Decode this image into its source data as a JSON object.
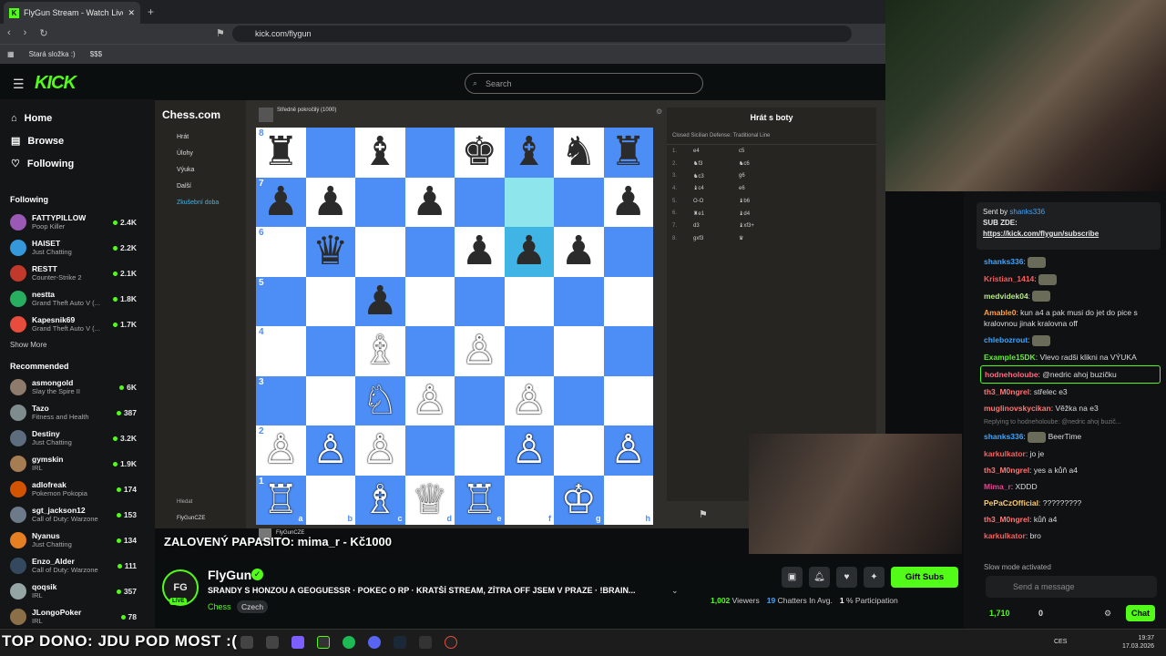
{
  "browser": {
    "tab_title": "FlyGun Stream - Watch Live o",
    "new_tab": "+",
    "url": "kick.com/flygun",
    "bookmarks": [
      "Stará složka :)",
      "$$$"
    ]
  },
  "kick": {
    "logo": "KICK",
    "search_placeholder": "Search",
    "nav": [
      {
        "label": "Home",
        "icon": "home-icon"
      },
      {
        "label": "Browse",
        "icon": "browse-icon"
      },
      {
        "label": "Following",
        "icon": "heart-icon"
      }
    ],
    "following_title": "Following",
    "following": [
      {
        "name": "FATTYPILLOW",
        "game": "Poop Killer",
        "count": "2.4K",
        "color": "#9b59b6"
      },
      {
        "name": "HAISET",
        "game": "Just Chatting",
        "count": "2.2K",
        "color": "#3498db"
      },
      {
        "name": "RESTT",
        "game": "Counter-Strike 2",
        "count": "2.1K",
        "color": "#c0392b"
      },
      {
        "name": "nestta",
        "game": "Grand Theft Auto V (...",
        "count": "1.8K",
        "color": "#27ae60"
      },
      {
        "name": "Kapesnik69",
        "game": "Grand Theft Auto V (...",
        "count": "1.7K",
        "color": "#e74c3c"
      }
    ],
    "show_more": "Show More",
    "recommended_title": "Recommended",
    "recommended": [
      {
        "name": "asmongold",
        "game": "Slay the Spire II",
        "count": "6K",
        "color": "#8e7b6b"
      },
      {
        "name": "Tazo",
        "game": "Fitness and Health",
        "count": "387",
        "color": "#7f8c8d"
      },
      {
        "name": "Destiny",
        "game": "Just Chatting",
        "count": "3.2K",
        "color": "#5d6d7e"
      },
      {
        "name": "gymskin",
        "game": "IRL",
        "count": "1.9K",
        "color": "#a67c52"
      },
      {
        "name": "adlofreak",
        "game": "Pokemon Pokopia",
        "count": "174",
        "color": "#d35400"
      },
      {
        "name": "sgt_jackson12",
        "game": "Call of Duty: Warzone",
        "count": "153",
        "color": "#6c7a89"
      },
      {
        "name": "Nyanus",
        "game": "Just Chatting",
        "count": "134",
        "color": "#e67e22"
      },
      {
        "name": "Enzo_Alder",
        "game": "Call of Duty: Warzone",
        "count": "111",
        "color": "#34495e"
      },
      {
        "name": "qoqsik",
        "game": "IRL",
        "count": "357",
        "color": "#95a5a6"
      },
      {
        "name": "JLongoPoker",
        "game": "IRL",
        "count": "78",
        "color": "#8b6f47"
      }
    ]
  },
  "chesscom": {
    "logo": "Chess.com",
    "menu": [
      "Hrát",
      "Úlohy",
      "Výuka",
      "Další",
      "Zkušební doba"
    ],
    "search": "Hledat",
    "user": "FlyGunCZE",
    "opponent": "Středně pokročilý (1000)",
    "player": "FlyGunCZE",
    "panel_title": "Hrát s boty",
    "opening": "Closed Sicilian Defense: Traditional Line",
    "moves": [
      [
        "1.",
        "e4",
        "c5"
      ],
      [
        "2.",
        "♞f3",
        "♞c6"
      ],
      [
        "3.",
        "♞c3",
        "g6"
      ],
      [
        "4.",
        "♝c4",
        "e6"
      ],
      [
        "5.",
        "O-O",
        "♝b6"
      ],
      [
        "6.",
        "♜e1",
        "♝d4"
      ],
      [
        "7.",
        "d3",
        "♝xf3+"
      ],
      [
        "8.",
        "gxf3",
        "♛"
      ]
    ],
    "board": [
      [
        "♜",
        "",
        "♝",
        "",
        "♚",
        "♝",
        "♞",
        "♜"
      ],
      [
        "♟",
        "♟",
        "",
        "♟",
        "",
        "",
        "",
        "♟"
      ],
      [
        "",
        "♛",
        "",
        "",
        "♟",
        "♟",
        "♟",
        ""
      ],
      [
        "",
        "",
        "♟",
        "",
        "",
        "",
        "",
        ""
      ],
      [
        "",
        "",
        "♗",
        "",
        "♙",
        "",
        "",
        ""
      ],
      [
        "",
        "",
        "♘",
        "♙",
        "",
        "♙",
        "",
        ""
      ],
      [
        "♙",
        "♙",
        "♙",
        "",
        "",
        "♙",
        "",
        "♙"
      ],
      [
        "♖",
        "",
        "♗",
        "♕",
        "♖",
        "",
        "♔",
        ""
      ]
    ],
    "ranks": [
      "8",
      "7",
      "6",
      "5",
      "4",
      "3",
      "2",
      "1"
    ],
    "files": [
      "a",
      "b",
      "c",
      "d",
      "e",
      "f",
      "g",
      "h"
    ]
  },
  "overlay": {
    "subtitle": "ZALOVENÝ PAPASITO: mima_r - Kč1000",
    "top_dono": "TOP DONO: JDU POD MOST :("
  },
  "stream": {
    "channel": "FlyGun",
    "avatar_text": "FG",
    "live": "LIVE",
    "title": "SRANDY S HONZOU A GEOGUESSR · POKEC O RP · KRATŠÍ STREAM, ZÍTRA OFF JSEM V PRAZE · !BRAIN...",
    "category": "Chess",
    "tag": "Czech",
    "gift_label": "Gift Subs",
    "viewers": "1,002",
    "viewers_label": "Viewers",
    "chatters": "19",
    "chatters_label": "Chatters In Avg.",
    "participation": "1",
    "participation_label": "% Participation"
  },
  "chat": {
    "pinned_sent_by": "Sent by",
    "pinned_user": "shanks336",
    "pinned_text": "SUB ZDE:",
    "pinned_link": "https://kick.com/flygun/subscribe",
    "messages": [
      {
        "user": "shanks336",
        "text": "",
        "color": "#3ea6ff",
        "emote": true
      },
      {
        "user": "Kristian_1414",
        "text": "",
        "color": "#ff5c5c",
        "emote": true
      },
      {
        "user": "medvidek04",
        "text": "",
        "color": "#b8e986",
        "emote": true
      },
      {
        "user": "Amable0",
        "text": "kun a4 a pak musi do jet do pice s kralovnou jinak kralovna off",
        "color": "#ff9f43",
        "emote": false
      },
      {
        "user": "chlebozrout",
        "text": "",
        "color": "#3ea6ff",
        "emote": true
      },
      {
        "user": "Example15DK",
        "text": "Vlevo radši klikni na VÝUKA",
        "color": "#53fc18",
        "emote": false
      },
      {
        "user": "hodneholoube",
        "text": "@nedric ahoj buzičku",
        "color": "#ff6b81",
        "emote": false
      },
      {
        "user": "th3_M0ngrel",
        "text": "střelec e3",
        "color": "#ff7675",
        "emote": false
      },
      {
        "user": "muglinovskycikan",
        "text": "Věžka na e3",
        "color": "#ff7675",
        "emote": false
      },
      {
        "user": "shanks336",
        "text": "BeerTime",
        "color": "#3ea6ff",
        "emote": true
      },
      {
        "user": "karkulkator",
        "text": "jo je",
        "color": "#ff5c5c",
        "emote": false
      },
      {
        "user": "th3_M0ngrel",
        "text": "yes a kůň a4",
        "color": "#ff7675",
        "emote": false
      },
      {
        "user": "Mima_r",
        "text": "XDDD",
        "color": "#e84393",
        "emote": false
      },
      {
        "user": "PePaCzOfficial",
        "text": "?????????",
        "color": "#fdcb6e",
        "emote": false
      },
      {
        "user": "th3_M0ngrel",
        "text": "kůň a4",
        "color": "#ff7675",
        "emote": false
      },
      {
        "user": "karkulkator",
        "text": "bro",
        "color": "#ff5c5c",
        "emote": false
      }
    ],
    "reply_note": "Replying to hodneholoube: @nedric ahoj buzič...",
    "slow_mode": "Slow mode activated",
    "placeholder": "Send a message",
    "balance": "1,710",
    "zero": "0",
    "chat_btn": "Chat"
  },
  "taskbar": {
    "lang": "CES",
    "time": "19:37",
    "date": "17.03.2026"
  }
}
